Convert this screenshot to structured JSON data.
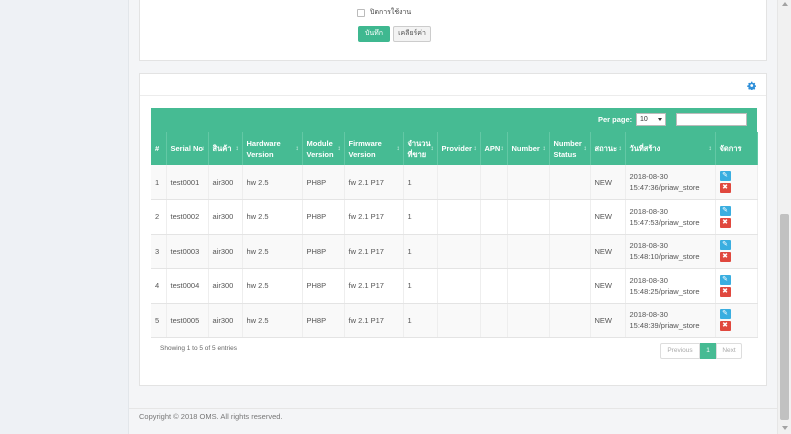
{
  "form": {
    "checkbox_label": "ปิดการใช้งาน",
    "save_label": "บันทึก",
    "clear_label": "เคลียร์ค่า"
  },
  "table_toolbar": {
    "per_page_label": "Per page:",
    "per_page_value": "10",
    "search_placeholder": ""
  },
  "columns": [
    "#",
    "Serial No",
    "สินค้า",
    "Hardware Version",
    "Module Version",
    "Firmware Version",
    "จำนวนที่ขาย",
    "Provider",
    "APN",
    "Number",
    "Number Status",
    "สถานะ",
    "วันที่สร้าง",
    "จัดการ"
  ],
  "rows": [
    {
      "no": "1",
      "serial": "test0001",
      "product": "air300",
      "hw": "hw 2.5",
      "module": "PH8P",
      "fw": "fw 2.1 P17",
      "qty": "1",
      "provider": "",
      "apn": "",
      "number": "",
      "number_status": "",
      "status": "NEW",
      "created": "2018-08-30 15:47:36/priaw_store"
    },
    {
      "no": "2",
      "serial": "test0002",
      "product": "air300",
      "hw": "hw 2.5",
      "module": "PH8P",
      "fw": "fw 2.1 P17",
      "qty": "1",
      "provider": "",
      "apn": "",
      "number": "",
      "number_status": "",
      "status": "NEW",
      "created": "2018-08-30 15:47:53/priaw_store"
    },
    {
      "no": "3",
      "serial": "test0003",
      "product": "air300",
      "hw": "hw 2.5",
      "module": "PH8P",
      "fw": "fw 2.1 P17",
      "qty": "1",
      "provider": "",
      "apn": "",
      "number": "",
      "number_status": "",
      "status": "NEW",
      "created": "2018-08-30 15:48:10/priaw_store"
    },
    {
      "no": "4",
      "serial": "test0004",
      "product": "air300",
      "hw": "hw 2.5",
      "module": "PH8P",
      "fw": "fw 2.1 P17",
      "qty": "1",
      "provider": "",
      "apn": "",
      "number": "",
      "number_status": "",
      "status": "NEW",
      "created": "2018-08-30 15:48:25/priaw_store"
    },
    {
      "no": "5",
      "serial": "test0005",
      "product": "air300",
      "hw": "hw 2.5",
      "module": "PH8P",
      "fw": "fw 2.1 P17",
      "qty": "1",
      "provider": "",
      "apn": "",
      "number": "",
      "number_status": "",
      "status": "NEW",
      "created": "2018-08-30 15:48:39/priaw_store"
    }
  ],
  "table_info": "Showing 1 to 5 of 5 entries",
  "pagination": {
    "prev": "Previous",
    "current": "1",
    "next": "Next"
  },
  "footer": "Copyright © 2018 OMS. All rights reserved.",
  "colors": {
    "accent": "#46bb93",
    "edit": "#3aaee0",
    "delete": "#e0483e"
  },
  "icons": {
    "settings": "gear-icon",
    "edit": "edit-icon",
    "delete": "close-icon"
  }
}
